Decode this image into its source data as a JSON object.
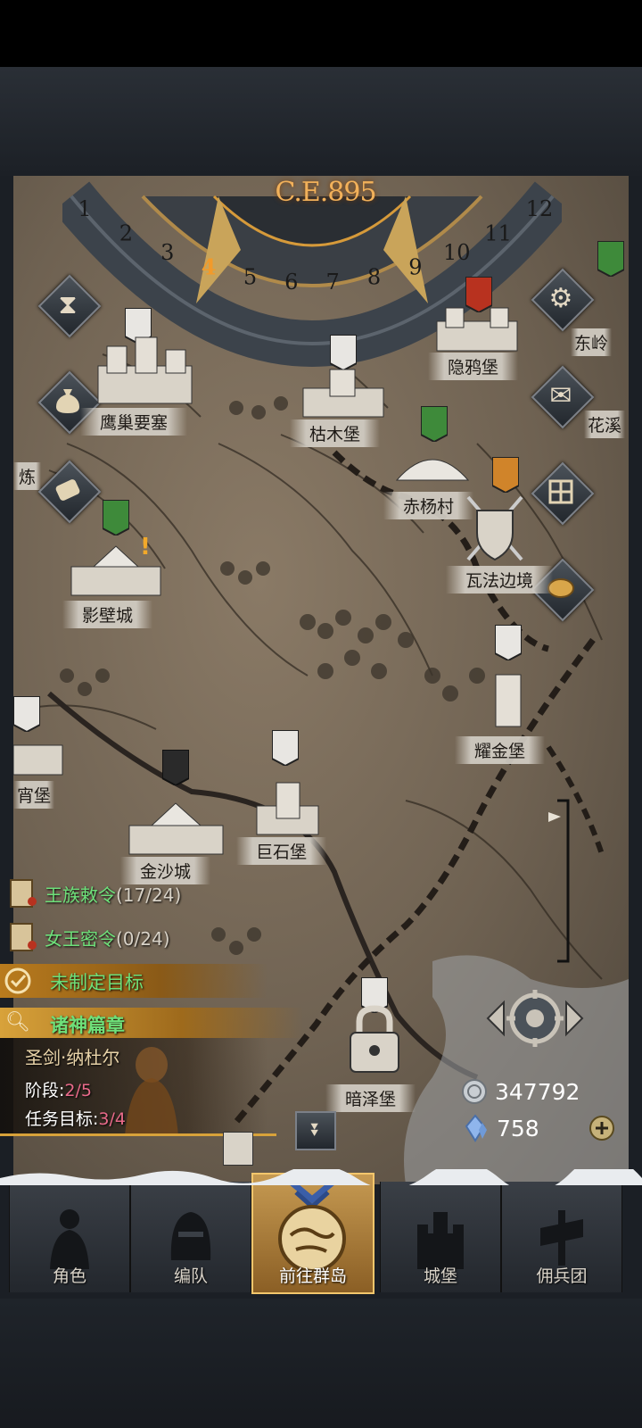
{
  "calendar": {
    "era": "C.E.895",
    "months": [
      "1",
      "2",
      "3",
      "4",
      "5",
      "6",
      "7",
      "8",
      "9",
      "10",
      "11",
      "12"
    ],
    "current_month": "4"
  },
  "castles": [
    {
      "name": "鹰巢要塞",
      "banner": "white"
    },
    {
      "name": "枯木堡",
      "banner": "white"
    },
    {
      "name": "隐鸦堡",
      "banner": "red"
    },
    {
      "name": "东岭",
      "banner": "green"
    },
    {
      "name": "花溪",
      "banner": "none"
    },
    {
      "name": "赤杨村",
      "banner": "green"
    },
    {
      "name": "瓦法边境",
      "banner": "orange"
    },
    {
      "name": "炼",
      "banner": "none"
    },
    {
      "name": "影壁城",
      "banner": "green",
      "alert": "!"
    },
    {
      "name": "耀金堡",
      "banner": "white"
    },
    {
      "name": "宵堡",
      "banner": "white"
    },
    {
      "name": "金沙城",
      "banner": "black"
    },
    {
      "name": "巨石堡",
      "banner": "white"
    },
    {
      "name": "暗泽堡",
      "banner": "white",
      "locked": true
    }
  ],
  "side_buttons": {
    "left": [
      "hourglass-icon",
      "money-bag-icon",
      "scroll-icon"
    ],
    "right": [
      "gear-icon",
      "mail-icon",
      "grid-icon",
      "coin-icon"
    ]
  },
  "quests": {
    "royal_edict": {
      "title": "王族敕令",
      "count": "(17/24)"
    },
    "queen_secret": {
      "title": "女王密令",
      "count": "(0/24)"
    },
    "goal": "未制定目标",
    "chapter": {
      "title": "诸神篇章",
      "hero": "圣剑·纳杜尔",
      "stage_label": "阶段:",
      "stage_value": "2/5",
      "task_label": "任务目标:",
      "task_value": "3/4"
    }
  },
  "resources": {
    "silver": "347792",
    "crystal": "758"
  },
  "nav": [
    {
      "label": "角色",
      "icon": "knight-icon"
    },
    {
      "label": "编队",
      "icon": "helmet-icon"
    },
    {
      "label": "前往群岛",
      "icon": "island-map-icon",
      "active": true
    },
    {
      "label": "城堡",
      "icon": "castle-icon"
    },
    {
      "label": "佣兵团",
      "icon": "mercenary-icon"
    }
  ],
  "colors": {
    "quest_green": "#6ee07a",
    "era_orange": "#f2b15a",
    "chapter_gold": "#d8a23a",
    "progress_pink": "#e86a8a"
  }
}
